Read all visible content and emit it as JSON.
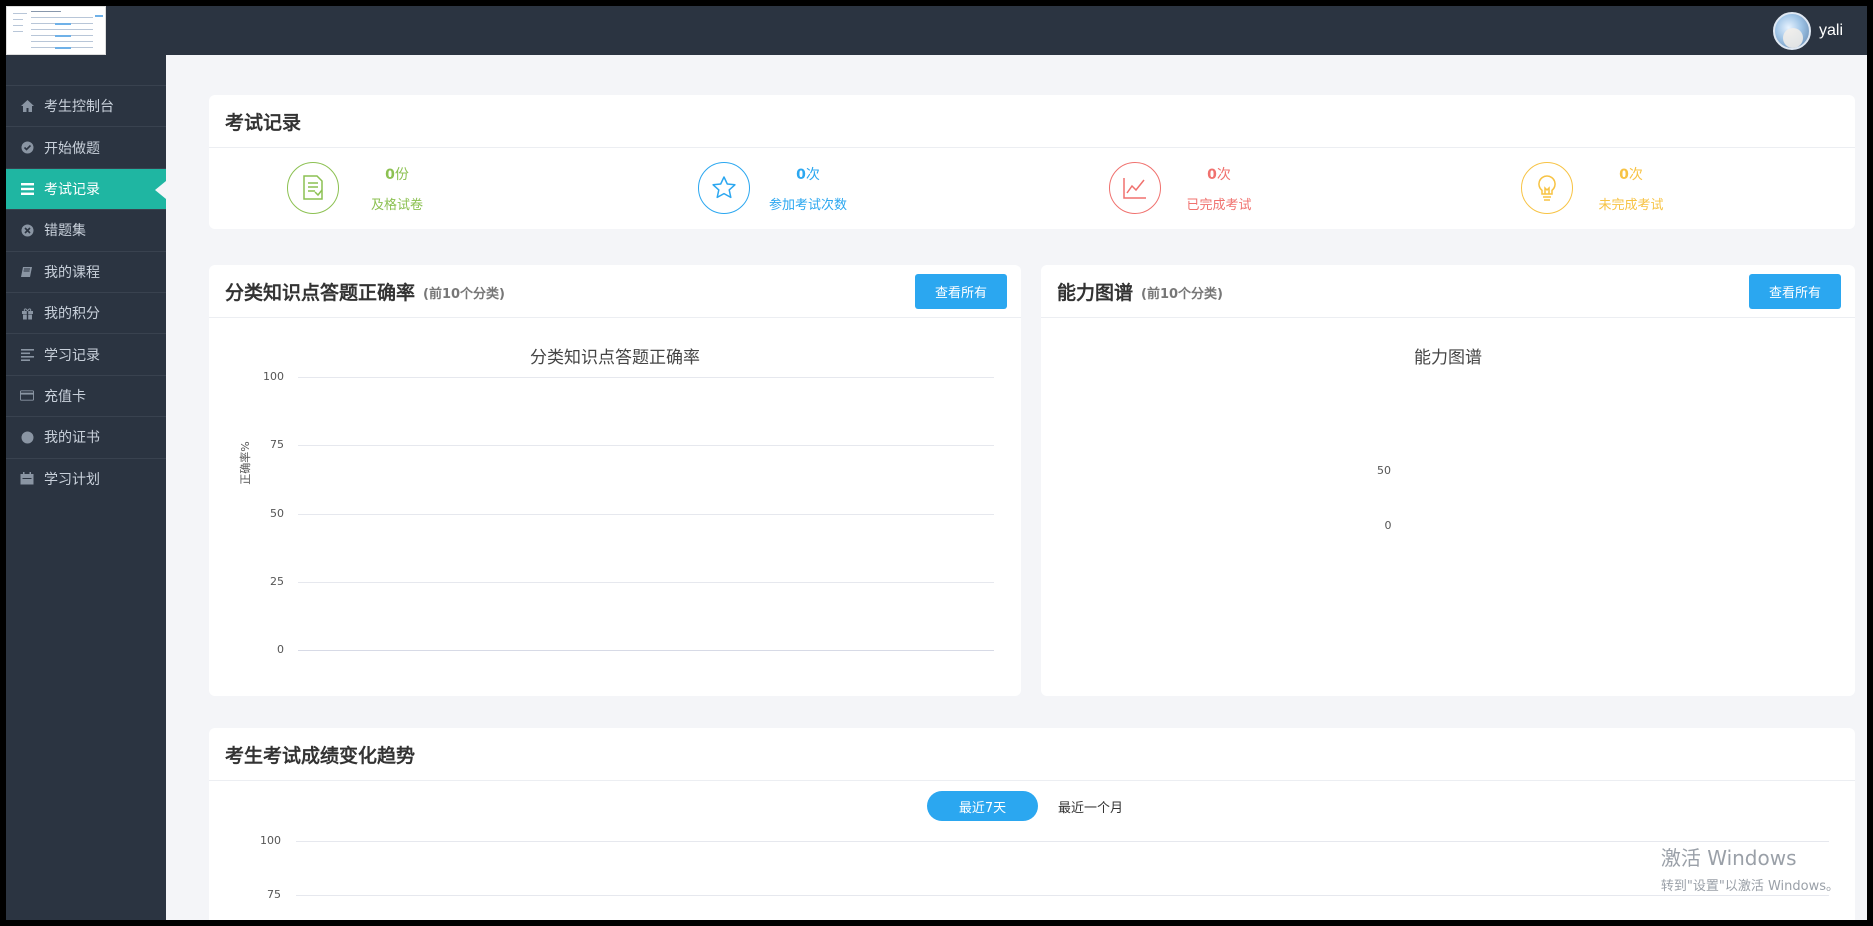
{
  "topbar": {
    "username": "yali"
  },
  "sidebar": {
    "items": [
      {
        "label": "考生控制台",
        "icon": "home-icon"
      },
      {
        "label": "开始做题",
        "icon": "check-circle-icon"
      },
      {
        "label": "考试记录",
        "icon": "list-icon",
        "active": true
      },
      {
        "label": "错题集",
        "icon": "close-circle-icon"
      },
      {
        "label": "我的课程",
        "icon": "book-icon"
      },
      {
        "label": "我的积分",
        "icon": "gift-icon"
      },
      {
        "label": "学习记录",
        "icon": "align-left-icon"
      },
      {
        "label": "充值卡",
        "icon": "credit-card-icon"
      },
      {
        "label": "我的证书",
        "icon": "certificate-icon"
      },
      {
        "label": "学习计划",
        "icon": "calendar-icon"
      }
    ]
  },
  "exam_records": {
    "title": "考试记录",
    "stats": [
      {
        "value": "0",
        "unit": "份",
        "label": "及格试卷",
        "icon": "document-icon",
        "color": "#8cc152"
      },
      {
        "value": "0",
        "unit": "次",
        "label": "参加考试次数",
        "icon": "star-icon",
        "color": "#2ba7f0"
      },
      {
        "value": "0",
        "unit": "次",
        "label": "已完成考试",
        "icon": "line-chart-icon",
        "color": "#f0716e"
      },
      {
        "value": "0",
        "unit": "次",
        "label": "未完成考试",
        "icon": "lightbulb-icon",
        "color": "#f7c344"
      }
    ]
  },
  "accuracy_panel": {
    "title": "分类知识点答题正确率",
    "subtitle": "(前10个分类)",
    "button": "查看所有"
  },
  "ability_panel": {
    "title": "能力图谱",
    "subtitle": "(前10个分类)",
    "button": "查看所有"
  },
  "trend_panel": {
    "title": "考生考试成绩变化趋势",
    "tab_active": "最近7天",
    "tab_other": "最近一个月"
  },
  "watermark": {
    "line1": "激活 Windows",
    "line2": "转到\"设置\"以激活 Windows。"
  },
  "chart_data": [
    {
      "type": "bar",
      "title": "分类知识点答题正确率",
      "ylabel": "正确率%",
      "xlabel": "",
      "ylim": [
        0,
        100
      ],
      "yticks": [
        "100",
        "75",
        "50",
        "25",
        "0"
      ],
      "categories": [],
      "values": [],
      "grid": true
    },
    {
      "type": "radar",
      "title": "能力图谱",
      "ticks": [
        "50",
        "0"
      ],
      "categories": [],
      "values": []
    },
    {
      "type": "line",
      "title": "",
      "ylim": [
        0,
        100
      ],
      "yticks": [
        "100",
        "75"
      ],
      "x": [],
      "values": [],
      "grid": true
    }
  ]
}
